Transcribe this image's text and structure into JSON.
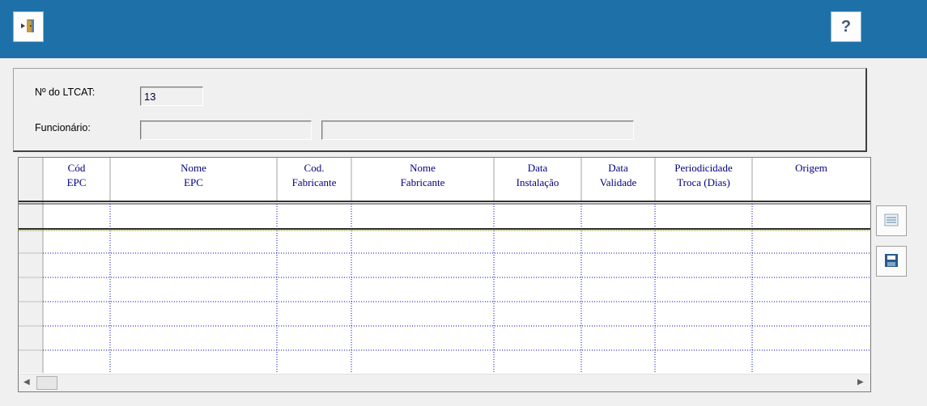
{
  "toolbar": {
    "exit_icon": "exit-door-icon",
    "help_label": "?"
  },
  "form": {
    "ltcat_label": "Nº do LTCAT:",
    "ltcat_value": "13",
    "employee_label": "Funcionário:",
    "employee_code": "",
    "employee_name": ""
  },
  "grid": {
    "columns": [
      {
        "line1": "Cód",
        "line2": "EPC"
      },
      {
        "line1": "Nome",
        "line2": "EPC"
      },
      {
        "line1": "Cod.",
        "line2": "Fabricante"
      },
      {
        "line1": "Nome",
        "line2": "Fabricante"
      },
      {
        "line1": "Data",
        "line2": "Instalação"
      },
      {
        "line1": "Data",
        "line2": "Validade"
      },
      {
        "line1": "Periodicidade",
        "line2": "Troca (Dias)"
      },
      {
        "line1": "Origem",
        "line2": ""
      }
    ],
    "rows": [
      [
        "",
        "",
        "",
        "",
        "",
        "",
        "",
        ""
      ],
      [
        "",
        "",
        "",
        "",
        "",
        "",
        "",
        ""
      ],
      [
        "",
        "",
        "",
        "",
        "",
        "",
        "",
        ""
      ],
      [
        "",
        "",
        "",
        "",
        "",
        "",
        "",
        ""
      ],
      [
        "",
        "",
        "",
        "",
        "",
        "",
        "",
        ""
      ],
      [
        "",
        "",
        "",
        "",
        "",
        "",
        "",
        ""
      ],
      [
        "",
        "",
        "",
        "",
        "",
        "",
        "",
        ""
      ]
    ]
  },
  "side_buttons": {
    "list_icon": "list-icon",
    "save_icon": "save-disk-icon"
  },
  "colors": {
    "titlebar": "#1d71a8",
    "header_text": "#000080",
    "grid_lines": "#0000c0"
  }
}
